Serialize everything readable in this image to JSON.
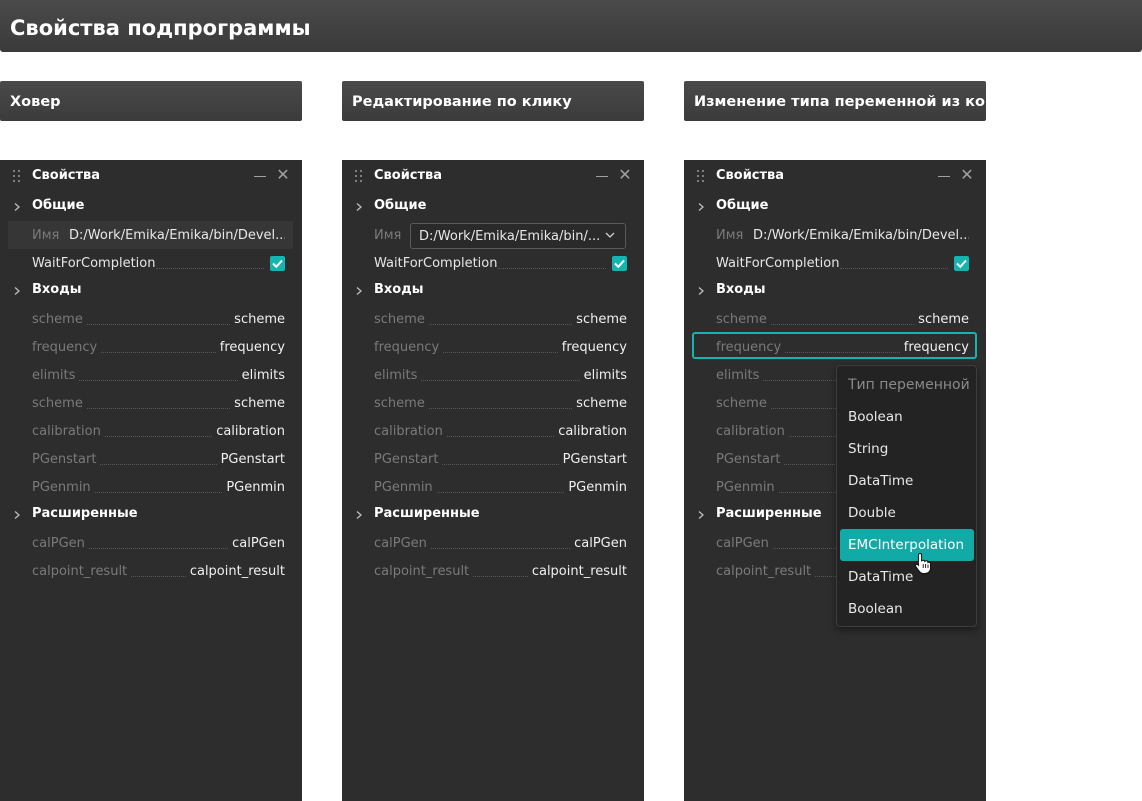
{
  "page_title": "Свойства подпрограммы",
  "sections": [
    {
      "caption": "Ховер"
    },
    {
      "caption": "Редактирование по клику"
    },
    {
      "caption": "Изменение типа переменной из контектного меню"
    }
  ],
  "panel": {
    "title": "Свойства",
    "groups": {
      "general": "Общие",
      "inputs": "Входы",
      "advanced": "Расширенные"
    },
    "name_label": "Имя",
    "name_value": "D:/Work/Emika/Emika/bin/Devel...",
    "name_value_edit": "D:/Work/Emika/Emika/bin/...",
    "wait_label": "WaitForCompletion",
    "wait_checked": true,
    "inputs": [
      {
        "key": "scheme",
        "value": "scheme"
      },
      {
        "key": "frequency",
        "value": "frequency"
      },
      {
        "key": "elimits",
        "value": "elimits"
      },
      {
        "key": "scheme",
        "value": "scheme"
      },
      {
        "key": "calibration",
        "value": "calibration"
      },
      {
        "key": "PGenstart",
        "value": "PGenstart"
      },
      {
        "key": "PGenmin",
        "value": "PGenmin"
      }
    ],
    "advanced": [
      {
        "key": "calPGen",
        "value": "calPGen"
      },
      {
        "key": "calpoint_result",
        "value": "calpoint_result"
      }
    ]
  },
  "context_menu": {
    "header": "Тип переменной",
    "items": [
      "Boolean",
      "String",
      "DataTime",
      "Double",
      "EMCInterpolation",
      "DataTime",
      "Boolean"
    ],
    "active_item": "EMCInterpolation"
  },
  "colors": {
    "accent": "#13b5b0",
    "panel_bg": "#2d2d2d",
    "header_bg": "#404040"
  }
}
